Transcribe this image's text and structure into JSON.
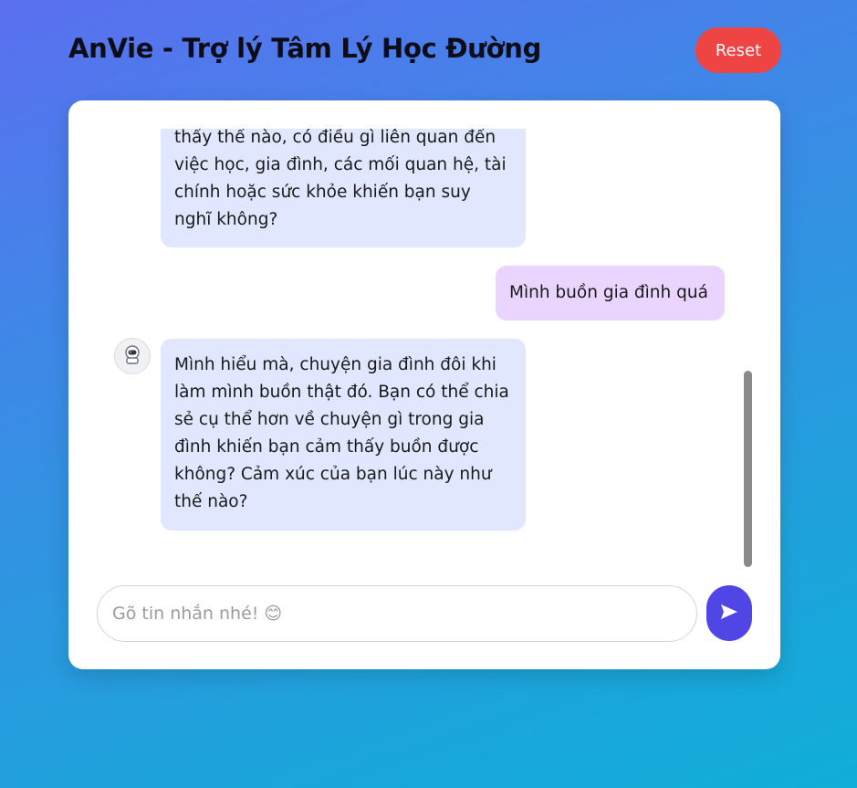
{
  "header": {
    "title": "AnVie - Trợ lý Tâm Lý Học Đường",
    "reset_label": "Reset"
  },
  "colors": {
    "reset": "#ef4444",
    "send": "#4f46e5",
    "bot_bubble": "#e0e7ff",
    "user_bubble": "#e9d5ff"
  },
  "messages": [
    {
      "role": "bot",
      "lines": [
        "thấy thế nào, có điều gì liên quan đến",
        "việc học, gia đình, các mối quan hệ, tài",
        "chính hoặc sức khỏe khiến bạn suy",
        "nghĩ không?"
      ]
    },
    {
      "role": "user",
      "text": "Mình buồn gia đình quá"
    },
    {
      "role": "bot",
      "avatar": "astronaut-icon",
      "lines": [
        "Mình hiểu mà, chuyện gia đình đôi khi",
        "làm mình buồn thật đó. Bạn có thể chia",
        "sẻ cụ thể hơn về chuyện gì trong gia",
        "đình khiến bạn cảm thấy buồn được",
        "không? Cảm xúc của bạn lúc này như",
        "thế nào?"
      ]
    }
  ],
  "composer": {
    "placeholder": "Gõ tin nhắn nhé! 😊",
    "value": "",
    "send_icon": "send-icon"
  }
}
